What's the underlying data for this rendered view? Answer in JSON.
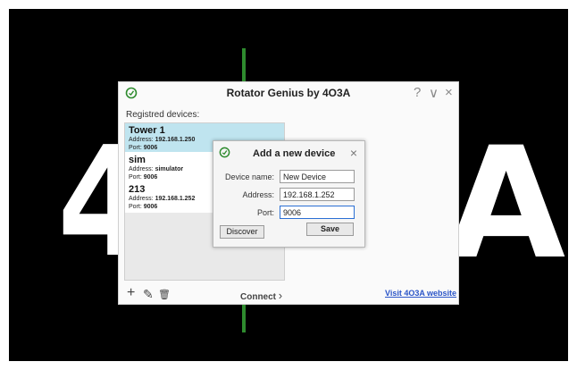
{
  "background": {
    "logo_left": "4",
    "logo_right": "A",
    "accent_green": "#2e8b2e"
  },
  "window": {
    "title": "Rotator Genius by 4O3A",
    "help": "?",
    "minimize": "∨",
    "close": "×",
    "registered_label": "Registred devices:",
    "devices": [
      {
        "name": "Tower 1",
        "address_label": "Address:",
        "address": "192.168.1.250",
        "port_label": "Port:",
        "port": "9006"
      },
      {
        "name": "sim",
        "address_label": "Address:",
        "address": "simulator",
        "port_label": "Port:",
        "port": "9006"
      },
      {
        "name": "213",
        "address_label": "Address:",
        "address": "192.168.1.252",
        "port_label": "Port:",
        "port": "9006"
      }
    ],
    "toolbar": {
      "add": "+",
      "edit": "✎",
      "delete": "🗑"
    },
    "connect_label": "Connect",
    "connect_arrow": "›",
    "visit_link": "Visit 4O3A website"
  },
  "dialog": {
    "title": "Add a new device",
    "close": "×",
    "device_name_label": "Device name:",
    "device_name_value": "New Device",
    "address_label": "Address:",
    "address_value": "192.168.1.252",
    "port_label": "Port:",
    "port_value": "9006",
    "discover_label": "Discover",
    "save_label": "Save"
  },
  "colors": {
    "selected_row": "#bfe4ef",
    "link": "#2a55c8",
    "brand_green": "#2e8b2e"
  }
}
